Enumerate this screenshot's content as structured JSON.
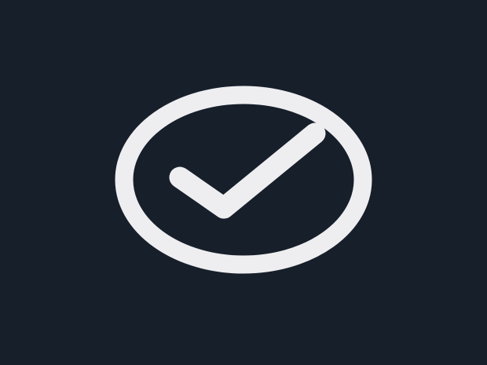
{
  "background_color": "#171f2b",
  "icon": {
    "name": "check-circle-icon",
    "stroke_color": "#eeeef0"
  }
}
